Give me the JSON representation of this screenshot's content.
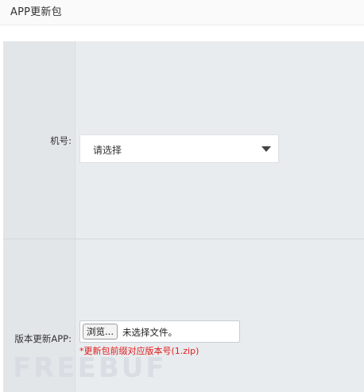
{
  "header": {
    "title": "APP更新包"
  },
  "form": {
    "machine_label": "机号:",
    "machine_select_value": "请选择",
    "version_label": "版本更新APP:",
    "browse_label": "浏览...",
    "file_status": "未选择文件。",
    "hint": "*更新包前缀对应版本号(1.zip)"
  },
  "watermark": {
    "text": "FREEBUF"
  },
  "colors": {
    "hint_red": "#e21b1b",
    "panel_bg": "#e9ecef",
    "label_col_bg": "#e3e6e9"
  },
  "icons": {
    "select_caret": "chevron-down-icon"
  }
}
